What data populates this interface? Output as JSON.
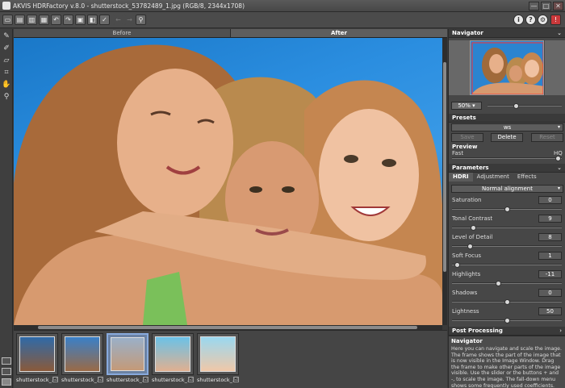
{
  "window": {
    "title": "AKVIS HDRFactory v.8.0 - shutterstock_53782489_1.jpg (RGB/8, 2344x1708)",
    "controls": [
      "—",
      "□",
      "✕"
    ]
  },
  "toolbar": {
    "left_icons": [
      "open-file",
      "save-file",
      "export",
      "print",
      "undo",
      "redo",
      "fit",
      "before-after",
      "apply"
    ],
    "right_icons": [
      "info",
      "help",
      "settings",
      "bug-report"
    ],
    "nav_arrows": [
      "←",
      "→",
      "zoom"
    ]
  },
  "tools": [
    "eyedropper",
    "brush",
    "eraser",
    "crop",
    "hand",
    "zoom"
  ],
  "view_tabs": {
    "before": "Before",
    "after": "After"
  },
  "filmstrip": {
    "items": [
      {
        "name": "shutterstock_...",
        "checked": "☑"
      },
      {
        "name": "shutterstock_...",
        "checked": "☑"
      },
      {
        "name": "shutterstock_...",
        "checked": "☑"
      },
      {
        "name": "shutterstock_...",
        "checked": "☑"
      },
      {
        "name": "shutterstock_...",
        "checked": "☑"
      }
    ]
  },
  "panel": {
    "navigator": {
      "title": "Navigator",
      "zoom": "50%"
    },
    "presets": {
      "title": "Presets",
      "current": "ws",
      "save": "Save",
      "delete": "Delete",
      "reset": "Reset"
    },
    "preview": {
      "title": "Preview",
      "fast": "Fast",
      "hq": "HQ"
    },
    "parameters": {
      "title": "Parameters",
      "tabs": [
        "HDRI",
        "Adjustment",
        "Effects"
      ],
      "mode": "Normal alignment",
      "params": [
        {
          "label": "Saturation",
          "value": "0",
          "level": 0.5
        },
        {
          "label": "Tonal Contrast",
          "value": "9",
          "level": 0.18
        },
        {
          "label": "Level of Detail",
          "value": "8",
          "level": 0.15
        },
        {
          "label": "Soft Focus",
          "value": "1",
          "level": 0.02
        },
        {
          "label": "Highlights",
          "value": "-11",
          "level": 0.42
        },
        {
          "label": "Shadows",
          "value": "0",
          "level": 0.5
        },
        {
          "label": "Lightness",
          "value": "50",
          "level": 0.5
        }
      ]
    },
    "post_processing": {
      "title": "Post Processing"
    },
    "help": {
      "title": "Navigator",
      "text": "Here you can navigate and scale the image. The frame shows the part of the image that is now visible in the Image Window. Drag the frame to make other parts of the image visible. Use the slider or the buttons + and -, to scale the image. The fall-down menu shows some frequently used coefficients."
    }
  },
  "colors": {
    "accent": "#88aadd",
    "sky": "#2b8ee0",
    "panel": "#474747"
  }
}
